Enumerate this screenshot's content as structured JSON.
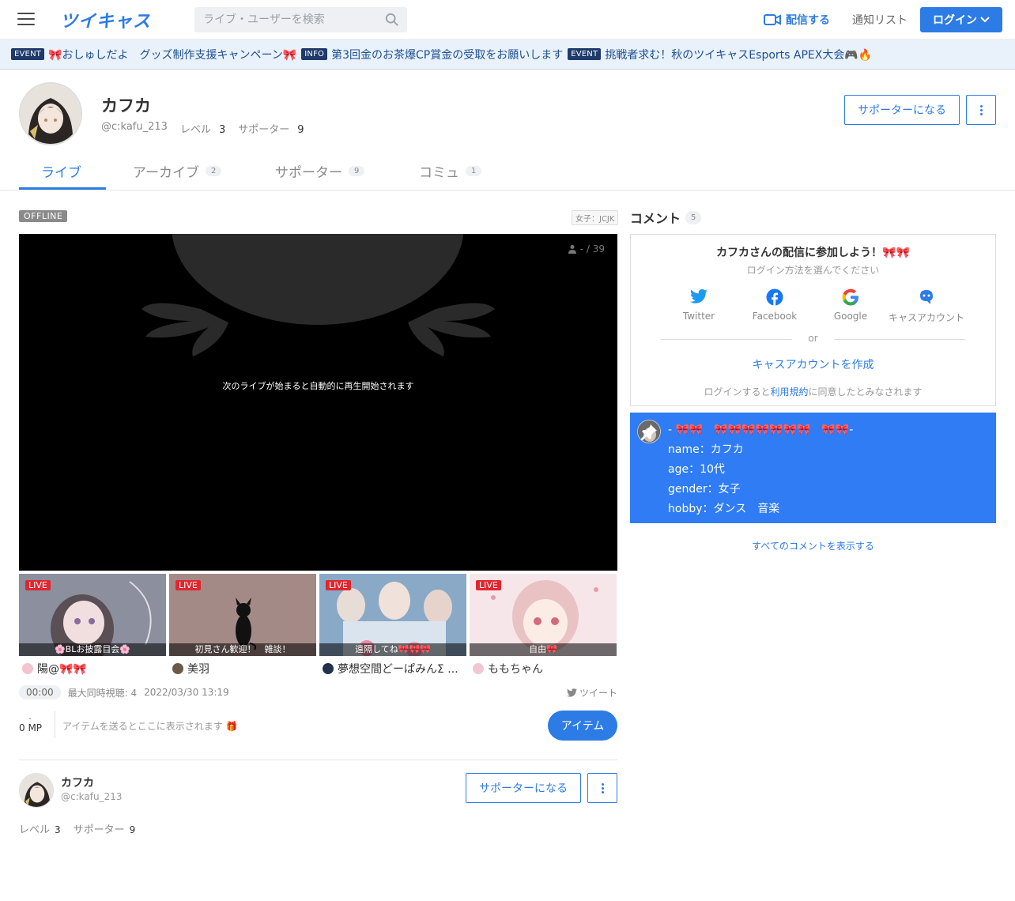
{
  "header": {
    "logo": "ツイキャス",
    "search_placeholder": "ライブ・ユーザーを検索",
    "broadcast_label": "配信する",
    "notify_label": "通知リスト",
    "login_label": "ログイン"
  },
  "ticker": [
    {
      "badge": "EVENT",
      "text": "🎀おしゅしだよ　グッズ制作支援キャンペーン🎀"
    },
    {
      "badge": "INFO",
      "text": "第3回金のお茶爆CP賞金の受取をお願いします"
    },
    {
      "badge": "EVENT",
      "text": "挑戦者求む！秋のツイキャスEsports APEX大会🎮🔥"
    }
  ],
  "profile": {
    "name": "カフカ",
    "id": "@c:kafu_213",
    "level_label": "レベル",
    "level": "3",
    "supporter_label": "サポーター",
    "supporters": "9",
    "supporter_button": "サポーターになる"
  },
  "tabs": [
    {
      "label": "ライブ",
      "count": ""
    },
    {
      "label": "アーカイブ",
      "count": "2"
    },
    {
      "label": "サポーター",
      "count": "9"
    },
    {
      "label": "コミュ",
      "count": "1"
    }
  ],
  "player": {
    "status": "OFFLINE",
    "genre": "女子：JCJK",
    "viewers": "- / 39",
    "message": "次のライブが始まると自動的に再生開始されます"
  },
  "recommendations": [
    {
      "live": "LIVE",
      "caption": "🌸BLお披露目会🌸",
      "owner": "陽@🎀🎀",
      "color": "#8b8f9e"
    },
    {
      "live": "LIVE",
      "caption": "初見さん歓迎！　雑談！",
      "owner": "美羽",
      "color": "#a48a86"
    },
    {
      "live": "LIVE",
      "caption": "遠隔してね🎀🎀🎀",
      "owner": "夢想空間どーぱみんΣ ...",
      "color": "#8aa9c6"
    },
    {
      "live": "LIVE",
      "caption": "自由🎀",
      "owner": "ももちゃん",
      "color": "#f2d9de"
    }
  ],
  "meta": {
    "time": "00:00",
    "max_viewers": "最大同時視聴: 4",
    "date": "2022/03/30 13:19",
    "tweet": "ツイート"
  },
  "items": {
    "mp_dash": "-",
    "mp": "0 MP",
    "hint": "アイテムを送るとここに表示されます 🎁",
    "button": "アイテム"
  },
  "bottom_profile": {
    "name": "カフカ",
    "id": "@c:kafu_213",
    "level_label": "レベル",
    "level": "3",
    "supporter_label": "サポーター",
    "supporters": "9",
    "supporter_button": "サポーターになる"
  },
  "comments": {
    "title": "コメント",
    "count": "5",
    "login_title": "カフカさんの配信に参加しよう！🎀🎀",
    "login_sub": "ログイン方法を選んでください",
    "providers": [
      "Twitter",
      "Facebook",
      "Google",
      "キャスアカウント"
    ],
    "or": "or",
    "create": "キャスアカウントを作成",
    "terms_pre": "ログインすると",
    "terms_link": "利用規約",
    "terms_post": "に同意したとみなされます",
    "pinned_lines": [
      "- 🎀🎀　🎀🎀🎀🎀🎀🎀🎀　🎀🎀-",
      "name：カフカ",
      "age：10代",
      "gender：女子",
      "hobby：ダンス　音楽"
    ],
    "show_all": "すべてのコメントを表示する"
  },
  "colors": {
    "accent": "#2d7be5",
    "pinned_bg": "#2f7cf4",
    "live_red": "#e0262f"
  }
}
